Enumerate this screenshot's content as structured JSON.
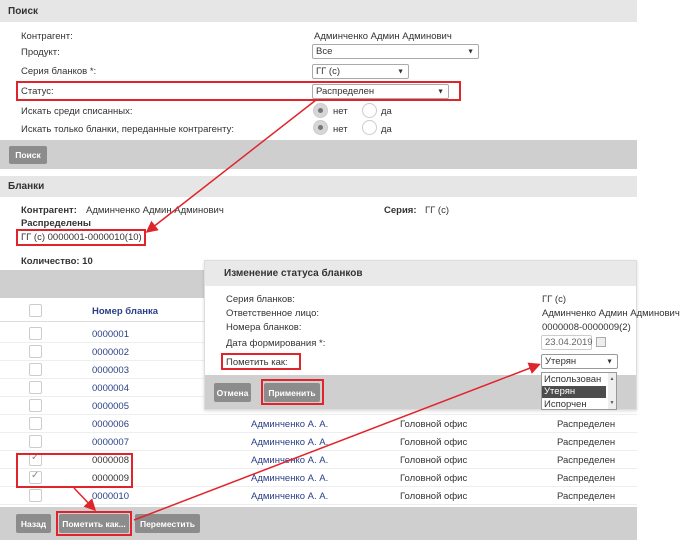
{
  "search": {
    "title": "Поиск",
    "contractor_label": "Контрагент:",
    "contractor_value": "Админченко Админ Админович",
    "product_label": "Продукт:",
    "product_value": "Все",
    "series_label": "Серия бланков *:",
    "series_value": "ГГ (с)",
    "status_label": "Статус:",
    "status_value": "Распределен",
    "written_off_label": "Искать среди списанных:",
    "transferred_label": "Искать только бланки, переданные контрагенту:",
    "no": "нет",
    "yes": "да",
    "search_button": "Поиск"
  },
  "blanks": {
    "title": "Бланки",
    "contractor_label": "Контрагент:",
    "contractor_value": "Админченко Админ Админович",
    "series_label": "Серия:",
    "series_value": "ГГ (с)",
    "group_title": "Распределены",
    "range": "ГГ (с) 0000001-0000010(10)",
    "count": "Количество: 10",
    "column_number": "Номер бланка",
    "rows": [
      {
        "number": "0000001",
        "checked": false,
        "person": "",
        "office": "",
        "status": ""
      },
      {
        "number": "0000002",
        "checked": false,
        "person": "",
        "office": "",
        "status": ""
      },
      {
        "number": "0000003",
        "checked": false,
        "person": "",
        "office": "",
        "status": ""
      },
      {
        "number": "0000004",
        "checked": false,
        "person": "",
        "office": "",
        "status": ""
      },
      {
        "number": "0000005",
        "checked": false,
        "person": "",
        "office": "",
        "status": ""
      },
      {
        "number": "0000006",
        "checked": false,
        "person": "Админченко А. А.",
        "office": "Головной офис",
        "status": "Распределен"
      },
      {
        "number": "0000007",
        "checked": false,
        "person": "Админченко А. А.",
        "office": "Головной офис",
        "status": "Распределен"
      },
      {
        "number": "0000008",
        "checked": true,
        "person": "Админченко А. А.",
        "office": "Головной офис",
        "status": "Распределен"
      },
      {
        "number": "0000009",
        "checked": true,
        "person": "Админченко А. А.",
        "office": "Головной офис",
        "status": "Распределен"
      },
      {
        "number": "0000010",
        "checked": false,
        "person": "Админченко А. А.",
        "office": "Головной офис",
        "status": "Распределен"
      }
    ],
    "back_button": "Назад",
    "mark_button": "Пометить как...",
    "move_button": "Переместить"
  },
  "dialog": {
    "title": "Изменение статуса бланков",
    "series_label": "Серия бланков:",
    "series_value": "ГГ (с)",
    "responsible_label": "Ответственное лицо:",
    "responsible_value": "Админченко Админ Админович",
    "numbers_label": "Номера бланков:",
    "numbers_value": "0000008-0000009(2)",
    "date_label": "Дата формирования *:",
    "date_value": "23.04.2019",
    "mark_label": "Пометить как:",
    "mark_value": "Утерян",
    "options": [
      "Использован",
      "Утерян",
      "Испорчен"
    ],
    "cancel_button": "Отмена",
    "apply_button": "Применить"
  },
  "colors": {
    "highlight_red": "#e0242b",
    "selected_option": "#4d4d4d",
    "link": "#2a3f86"
  }
}
